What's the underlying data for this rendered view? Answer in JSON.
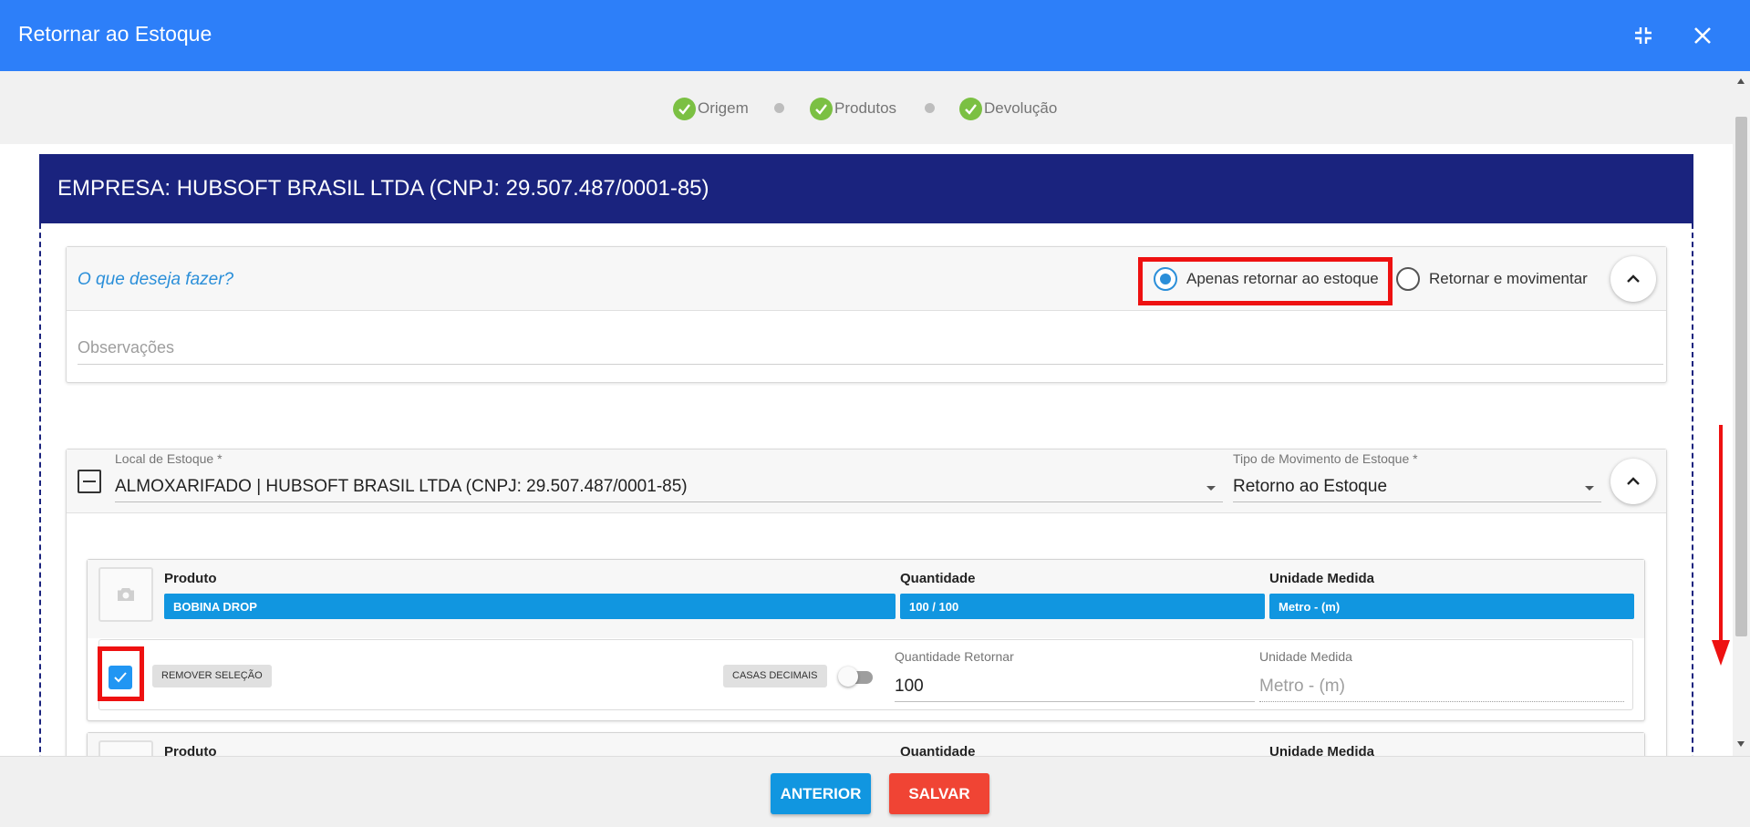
{
  "header": {
    "title": "Retornar ao Estoque"
  },
  "stepper": {
    "steps": [
      {
        "label": "Origem"
      },
      {
        "label": "Produtos"
      },
      {
        "label": "Devolução"
      }
    ]
  },
  "company": {
    "title": "EMPRESA: HUBSOFT BRASIL LTDA (CNPJ: 29.507.487/0001-85)"
  },
  "action": {
    "question": "O que deseja fazer?",
    "options": [
      "Apenas retornar ao estoque",
      "Retornar e movimentar"
    ],
    "selected": "Apenas retornar ao estoque",
    "observations_placeholder": "Observações"
  },
  "stock": {
    "local_label": "Local de Estoque *",
    "local_value": "ALMOXARIFADO | HUBSOFT BRASIL LTDA (CNPJ: 29.507.487/0001-85)",
    "type_label": "Tipo de Movimento de Estoque *",
    "type_value": "Retorno ao Estoque"
  },
  "products": [
    {
      "product_label": "Produto",
      "product_value": "BOBINA DROP",
      "qty_label": "Quantidade",
      "qty_value": "100 / 100",
      "unit_label": "Unidade Medida",
      "unit_value": "Metro - (m)",
      "selected": true,
      "remove_selection_label": "REMOVER SELEÇÃO",
      "decimals_label": "CASAS DECIMAIS",
      "decimals_enabled": false,
      "return_qty_label": "Quantidade Retornar",
      "return_qty_value": "100",
      "return_unit_label": "Unidade Medida",
      "return_unit_value": "Metro - (m)"
    },
    {
      "product_label": "Produto",
      "qty_label": "Quantidade",
      "unit_label": "Unidade Medida"
    }
  ],
  "footer": {
    "prev_label": "ANTERIOR",
    "save_label": "SALVAR"
  },
  "colors": {
    "header": "#2d7ff9",
    "company_bar": "#1a237e",
    "step_done": "#7bc043",
    "value_chip": "#1196e0",
    "prev_button": "#1196e0",
    "save_button": "#f04434",
    "annotation": "#ee1111"
  }
}
